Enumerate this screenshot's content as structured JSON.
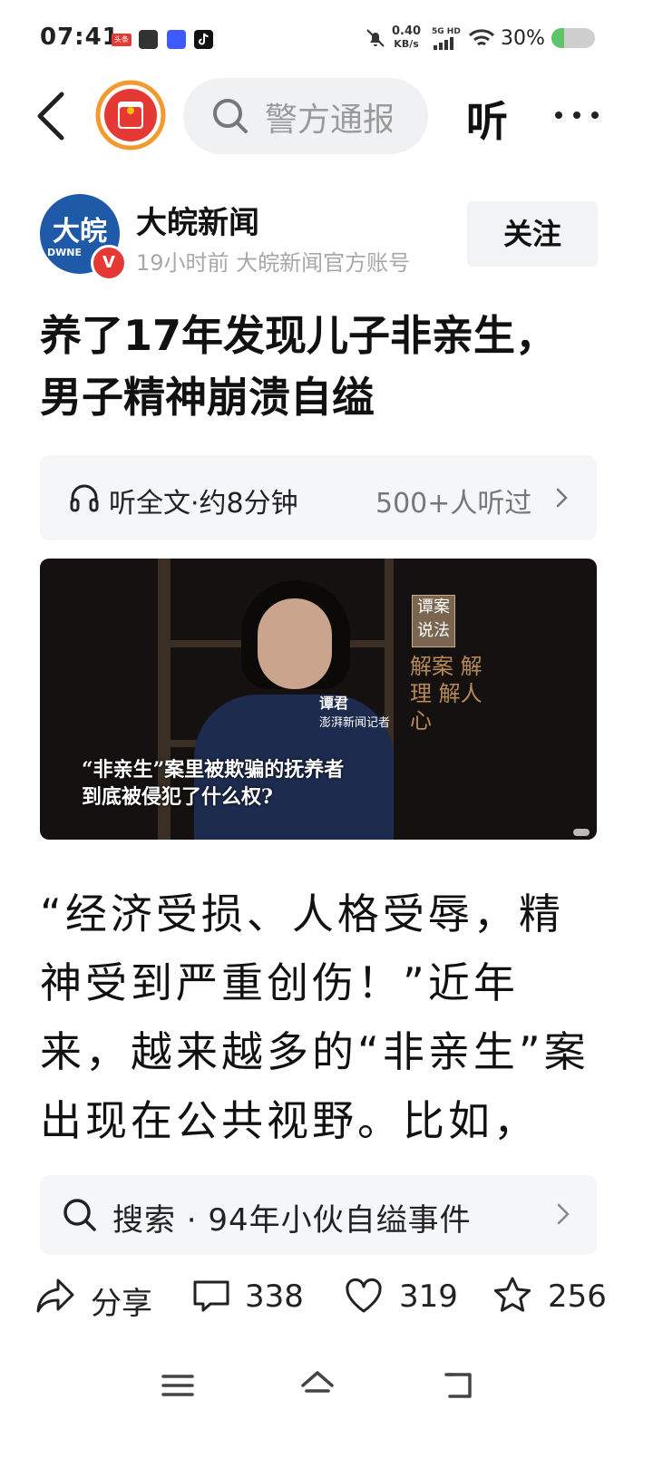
{
  "status_bar": {
    "time": "07:41",
    "app_badge": "头条",
    "network_speed_value": "0.40",
    "network_speed_unit": "KB/s",
    "network_type": "5G HD",
    "battery": "30%",
    "battery_level": 0.3
  },
  "nav": {
    "search_placeholder": "警方通报",
    "listen_label": "听"
  },
  "author": {
    "avatar_text": "大皖",
    "avatar_sub": "DWNE",
    "verified_mark": "V",
    "name": "大皖新闻",
    "meta": "19小时前  大皖新闻官方账号",
    "follow_label": "关注"
  },
  "article": {
    "title": "养了17年发现儿子非亲生，男子精神崩溃自缢",
    "listen_label": "听全文·约8分钟",
    "listen_count": "500+人听过",
    "body": "“经济受损、人格受辱，精神受到严重创伤！”近年来，越来越多的“非亲生”案出现在公共视野。比如，"
  },
  "video": {
    "person_name": "谭君",
    "person_role": "澎湃新闻记者",
    "badge": "谭案说法",
    "slogan": "解案 解理 解人心",
    "caption_line1": "“非亲生”案里被欺骗的抚养者",
    "caption_line2": "到底被侵犯了什么权?"
  },
  "suggestion": {
    "text": "搜索 · 94年小伙自缢事件"
  },
  "actions": {
    "share_label": "分享",
    "comments": "338",
    "likes": "319",
    "favorites": "256"
  },
  "colors": {
    "accent_red": "#e53935",
    "avatar_blue": "#1e5aa8",
    "battery_green": "#5ec46a",
    "muted_text": "#a8a8a8"
  }
}
